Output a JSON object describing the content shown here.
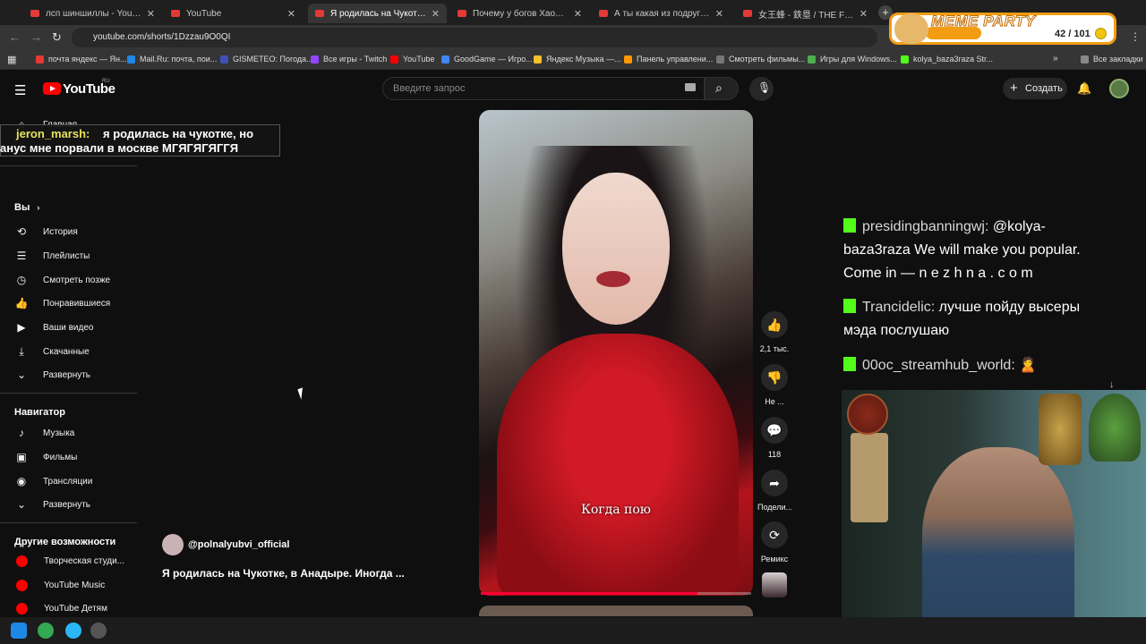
{
  "browser": {
    "tabs": [
      {
        "label": "лсп шиншиллы - YouTube",
        "active": false,
        "icon": "youtube-icon"
      },
      {
        "label": "YouTube",
        "active": false,
        "icon": "youtube-icon"
      },
      {
        "label": "Я родилась на Чукотке, в А",
        "active": true,
        "icon": "youtube-icon"
      },
      {
        "label": "Почему у богов Хаоса такие и",
        "active": false,
        "icon": "youtube-icon"
      },
      {
        "label": "А ты какая из подруг? 😵 BEAR",
        "active": false,
        "icon": "youtube-icon"
      },
      {
        "label": "女王蜂 - 鉄塁 / THE FIRST TAKE",
        "active": false,
        "icon": "youtube-icon"
      }
    ],
    "url": "youtube.com/shorts/1Dzzau9O0QI",
    "bookmarks": [
      {
        "label": "почта яндекс — Ян...",
        "color": "#e53935"
      },
      {
        "label": "Mail.Ru: почта, пои...",
        "color": "#1e88e5"
      },
      {
        "label": "GISMETEO: Погода...",
        "color": "#3f51b5"
      },
      {
        "label": "Все игры - Twitch",
        "color": "#9146ff"
      },
      {
        "label": "YouTube",
        "color": "#ff0000"
      },
      {
        "label": "GoodGame — Игро...",
        "color": "#4285f4"
      },
      {
        "label": "Яндекс Музыка —...",
        "color": "#fbc02d"
      },
      {
        "label": "Панель управлени...",
        "color": "#ff9800"
      },
      {
        "label": "Смотреть фильмы...",
        "color": "#777777"
      },
      {
        "label": "Игры для Windows...",
        "color": "#4caf50"
      },
      {
        "label": "kolya_baza3raza Str...",
        "color": "#53fc18"
      }
    ],
    "all_bookmarks": "Все закладки"
  },
  "meme_party": {
    "title": "MEME PARTY",
    "score": "42 / 101"
  },
  "youtube": {
    "logo_text": "YouTube",
    "region": "RU",
    "search_placeholder": "Введите запрос",
    "create_label": "Создать"
  },
  "sidebar": {
    "home": "Главная",
    "you_heading": "Вы",
    "you_items": [
      {
        "label": "История",
        "icon": "history-icon",
        "glyph": "⟲"
      },
      {
        "label": "Плейлисты",
        "icon": "playlists-icon",
        "glyph": "☰"
      },
      {
        "label": "Смотреть позже",
        "icon": "watch-later-icon",
        "glyph": "◷"
      },
      {
        "label": "Понравившиеся",
        "icon": "thumb-up-icon",
        "glyph": "👍"
      },
      {
        "label": "Ваши видео",
        "icon": "your-videos-icon",
        "glyph": "▶"
      },
      {
        "label": "Скачанные",
        "icon": "download-icon",
        "glyph": "⤓"
      },
      {
        "label": "Развернуть",
        "icon": "chevron-down-icon",
        "glyph": "⌄"
      }
    ],
    "nav_heading": "Навигатор",
    "nav_items": [
      {
        "label": "Музыка",
        "icon": "music-icon",
        "glyph": "♪"
      },
      {
        "label": "Фильмы",
        "icon": "film-icon",
        "glyph": "▣"
      },
      {
        "label": "Трансляции",
        "icon": "live-icon",
        "glyph": "◉"
      },
      {
        "label": "Развернуть",
        "icon": "chevron-down-icon",
        "glyph": "⌄"
      }
    ],
    "other_heading": "Другие возможности",
    "other_items": [
      {
        "label": "Творческая студи..."
      },
      {
        "label": "YouTube Music"
      },
      {
        "label": "YouTube Детям"
      }
    ]
  },
  "chat_popup": {
    "user": "jeron_marsh:",
    "message": "я родилась на чукотке, но анус мне порвали в москве МГЯГЯГЯГГЯ"
  },
  "short": {
    "caption": "Когда пою",
    "progress": 0.8,
    "channel": "@polnalyubvi_official",
    "title": "Я родилась на Чукотке, в Анадыре. Иногда ...",
    "likes": "2,1 тыс.",
    "dislike_label": "Не ...",
    "comments": "118",
    "share_label": "Подели...",
    "remix_label": "Ремикс"
  },
  "stream_chat": [
    {
      "user": "presidingbanningwj:",
      "message": "@kolya-baza3raza We will make you popular. Come in — n e z h n a . c o m"
    },
    {
      "user": "Trancidelic:",
      "message": "лучше пойду высеры мэда послушаю"
    },
    {
      "user": "00oc_streamhub_world:",
      "message": "🙎"
    }
  ]
}
